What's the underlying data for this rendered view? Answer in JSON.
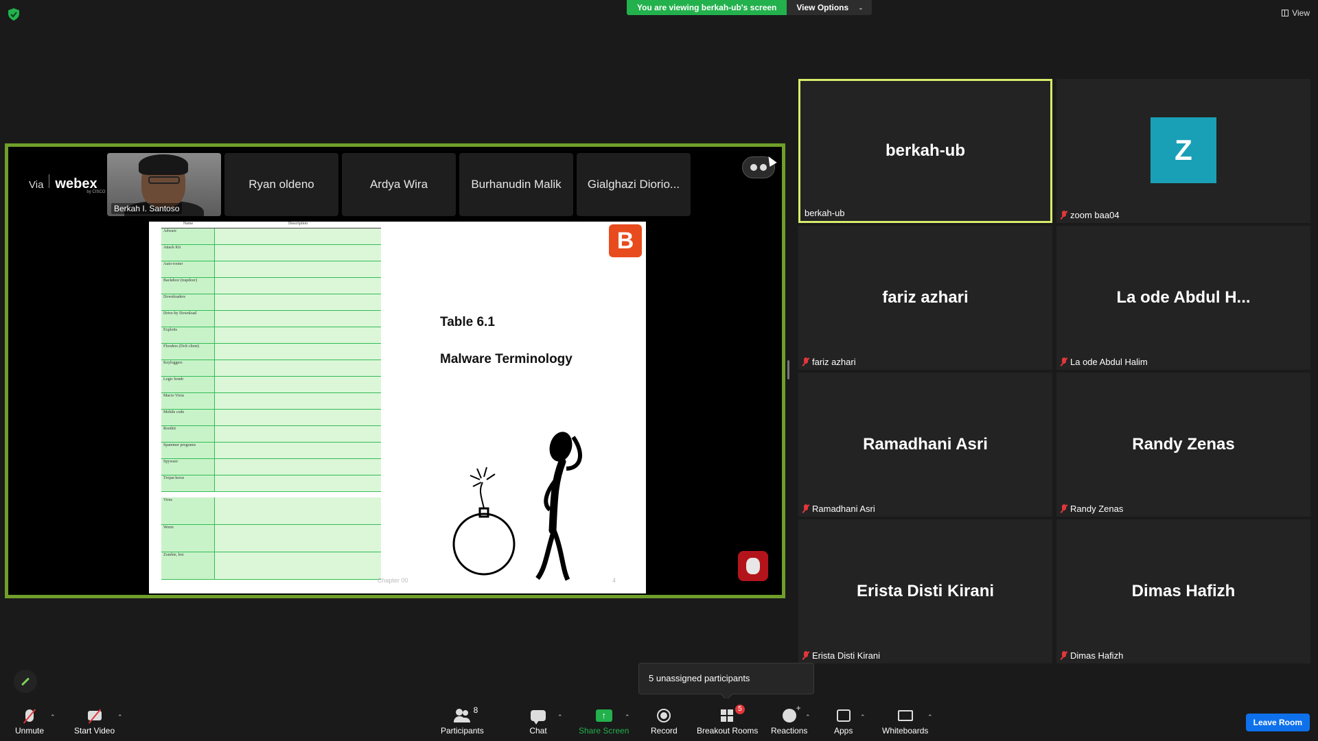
{
  "banner": {
    "viewing_text": "You are viewing berkah-ub's screen",
    "view_options_label": "View Options",
    "top_view_label": "View"
  },
  "shared_screen": {
    "brand_via": "Via",
    "brand_name": "webex",
    "brand_sub": "by CISCO",
    "tiles": [
      {
        "name": "Berkah I. Santoso",
        "has_video": true
      },
      {
        "name": "Ryan oldeno"
      },
      {
        "name": "Ardya Wira"
      },
      {
        "name": "Burhanudin Malik"
      },
      {
        "name": "Gialghazi Diorio..."
      }
    ],
    "slide": {
      "table_headers": [
        "Name",
        "Description"
      ],
      "table_rows": [
        "Adware",
        "Attack Kit",
        "Auto-rooter",
        "Backdoor (trapdoor)",
        "Downloaders",
        "Drive-by Download",
        "Exploits",
        "Flooders (DoS client)",
        "Keyloggers",
        "Logic bomb",
        "Macro Virus",
        "Mobile code",
        "Rootkit",
        "Spammer programs",
        "Spyware",
        "Trojan horse"
      ],
      "table_rows_2": [
        "Virus",
        "Worm",
        "Zombie, bot"
      ],
      "heading": "Table 6.1",
      "subheading": "Malware Terminology",
      "footer": "Chapter 00",
      "page": "4",
      "logo_letter": "B"
    }
  },
  "participants": [
    {
      "big": "berkah-ub",
      "small": "berkah-ub",
      "active": true,
      "muted": false
    },
    {
      "avatar": "Z",
      "small": "zoom baa04",
      "muted": true
    },
    {
      "big": "fariz azhari",
      "small": "fariz azhari",
      "muted": true
    },
    {
      "big": "La ode Abdul H...",
      "small": "La ode Abdul Halim",
      "muted": true
    },
    {
      "big": "Ramadhani Asri",
      "small": "Ramadhani Asri",
      "muted": true
    },
    {
      "big": "Randy Zenas",
      "small": "Randy Zenas",
      "muted": true
    },
    {
      "big": "Erista Disti Kirani",
      "small": "Erista Disti Kirani",
      "muted": true
    },
    {
      "big": "Dimas Hafizh",
      "small": "Dimas Hafizh",
      "muted": true
    }
  ],
  "tooltip": "5 unassigned participants",
  "toolbar": {
    "unmute": "Unmute",
    "start_video": "Start Video",
    "participants": "Participants",
    "participants_count": "8",
    "chat": "Chat",
    "share_screen": "Share Screen",
    "record": "Record",
    "breakout_rooms": "Breakout Rooms",
    "breakout_badge": "5",
    "reactions": "Reactions",
    "apps": "Apps",
    "whiteboards": "Whiteboards",
    "leave": "Leave Room"
  },
  "colors": {
    "share_green": "#23b14d",
    "active_border": "#d6ec6b",
    "frame_green": "#6f9e2a",
    "leave_blue": "#0e71eb",
    "avatar_teal": "#1aa0b6",
    "muted_red": "#e2363b"
  }
}
